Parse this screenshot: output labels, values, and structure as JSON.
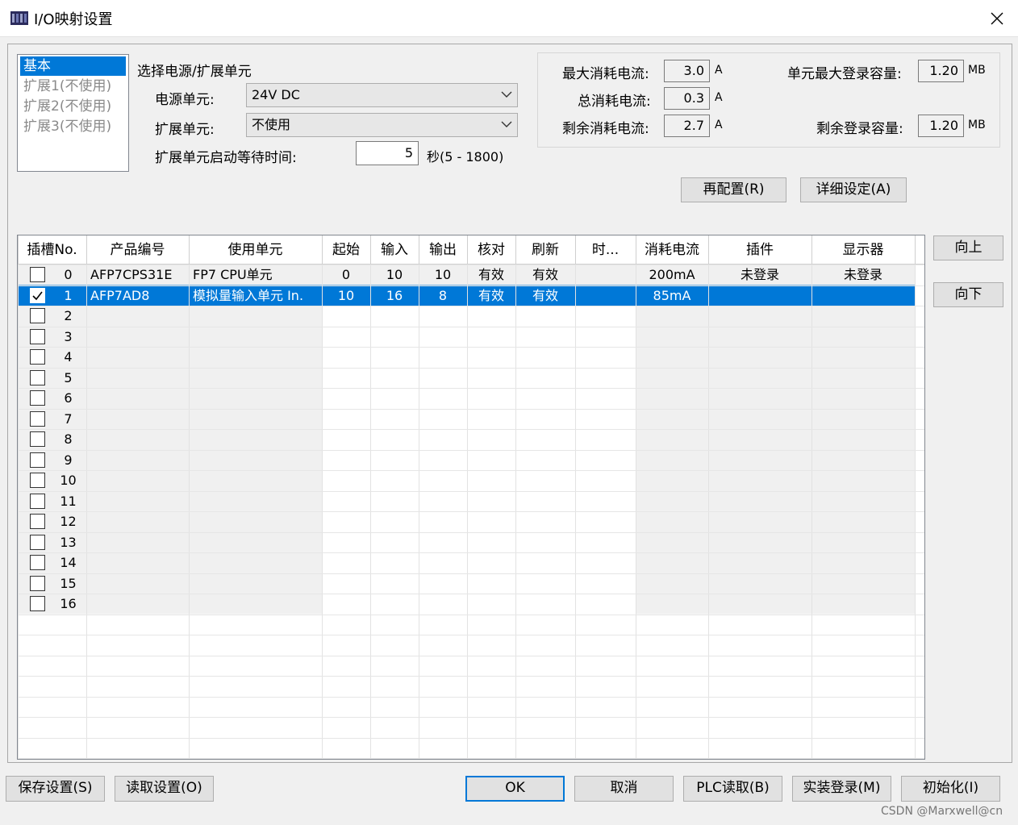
{
  "window": {
    "title": "I/O映射设置",
    "close_glyph": "✕"
  },
  "category_list": [
    {
      "label": "基本",
      "selected": true,
      "enabled": true
    },
    {
      "label": "扩展1(不使用)",
      "selected": false,
      "enabled": false
    },
    {
      "label": "扩展2(不使用)",
      "selected": false,
      "enabled": false
    },
    {
      "label": "扩展3(不使用)",
      "selected": false,
      "enabled": false
    }
  ],
  "power": {
    "section_title": "选择电源/扩展单元",
    "power_unit_label": "电源单元:",
    "power_unit_value": "24V DC",
    "expansion_unit_label": "扩展单元:",
    "expansion_unit_value": "不使用",
    "wait_time_label": "扩展单元启动等待时间:",
    "wait_time_value": "5",
    "wait_time_range": "秒(5 - 1800)"
  },
  "current": {
    "max_current_label": "最大消耗电流:",
    "max_current_value": "3.0",
    "total_current_label": "总消耗电流:",
    "total_current_value": "0.3",
    "remaining_current_label": "剩余消耗电流:",
    "remaining_current_value": "2.7",
    "current_unit": "A",
    "max_capacity_label": "单元最大登录容量:",
    "max_capacity_value": "1.20",
    "remaining_capacity_label": "剩余登录容量:",
    "remaining_capacity_value": "1.20",
    "capacity_unit": "MB"
  },
  "buttons": {
    "reconfigure": "再配置(R)",
    "details": "详细设定(A)",
    "move_up": "向上",
    "move_down": "向下",
    "save_settings": "保存设置(S)",
    "read_settings": "读取设置(O)",
    "ok": "OK",
    "cancel": "取消",
    "plc_read": "PLC读取(B)",
    "actual_register": "实装登录(M)",
    "initialize": "初始化(I)"
  },
  "grid": {
    "columns": [
      "插槽No.",
      "产品编号",
      "使用单元",
      "起始",
      "输入",
      "输出",
      "核对",
      "刷新",
      "时...",
      "消耗电流",
      "插件",
      "显示器"
    ],
    "rows": [
      {
        "checked": false,
        "selected": false,
        "slot": "0",
        "product": "AFP7CPS31E",
        "unit": "FP7 CPU单元",
        "start": "0",
        "input": "10",
        "output": "10",
        "verify": "有效",
        "refresh": "有效",
        "time": "",
        "current": "200mA",
        "plugin": "未登录",
        "display": "未登录"
      },
      {
        "checked": true,
        "selected": true,
        "slot": "1",
        "product": "AFP7AD8",
        "unit": "模拟量输入单元 In.",
        "start": "10",
        "input": "16",
        "output": "8",
        "verify": "有效",
        "refresh": "有效",
        "time": "",
        "current": "85mA",
        "plugin": "",
        "display": ""
      },
      {
        "checked": false,
        "selected": false,
        "slot": "2"
      },
      {
        "checked": false,
        "selected": false,
        "slot": "3"
      },
      {
        "checked": false,
        "selected": false,
        "slot": "4"
      },
      {
        "checked": false,
        "selected": false,
        "slot": "5"
      },
      {
        "checked": false,
        "selected": false,
        "slot": "6"
      },
      {
        "checked": false,
        "selected": false,
        "slot": "7"
      },
      {
        "checked": false,
        "selected": false,
        "slot": "8"
      },
      {
        "checked": false,
        "selected": false,
        "slot": "9"
      },
      {
        "checked": false,
        "selected": false,
        "slot": "10"
      },
      {
        "checked": false,
        "selected": false,
        "slot": "11"
      },
      {
        "checked": false,
        "selected": false,
        "slot": "12"
      },
      {
        "checked": false,
        "selected": false,
        "slot": "13"
      },
      {
        "checked": false,
        "selected": false,
        "slot": "14"
      },
      {
        "checked": false,
        "selected": false,
        "slot": "15"
      },
      {
        "checked": false,
        "selected": false,
        "slot": "16"
      }
    ]
  },
  "watermark": "CSDN @Marxwell@cn",
  "colors": {
    "selection": "#0078d7",
    "window_bg": "#f0f0f0",
    "grid_shade": "#f0f0f0"
  }
}
